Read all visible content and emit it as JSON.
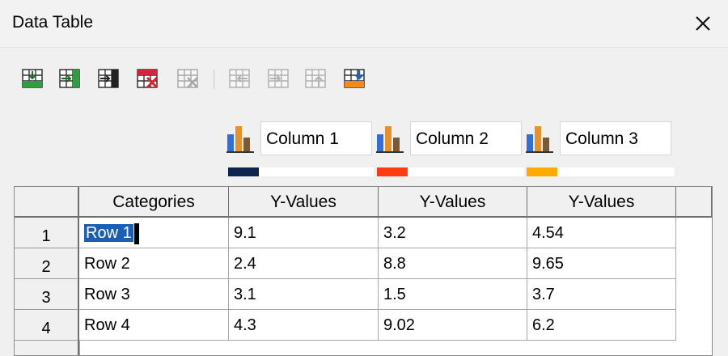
{
  "window": {
    "title": "Data Table"
  },
  "toolbar": {
    "buttons": [
      {
        "name": "insert-row-icon",
        "enabled": true
      },
      {
        "name": "insert-column-icon",
        "enabled": true
      },
      {
        "name": "insert-text-column-icon",
        "enabled": true
      },
      {
        "name": "delete-row-icon",
        "enabled": true
      },
      {
        "name": "delete-column-icon",
        "enabled": false
      },
      {
        "name": "move-column-left-icon",
        "enabled": false
      },
      {
        "name": "move-column-right-icon",
        "enabled": false
      },
      {
        "name": "move-row-up-icon",
        "enabled": false
      },
      {
        "name": "move-row-down-icon",
        "enabled": true
      }
    ]
  },
  "series": [
    {
      "name": "Column 1",
      "color": "#0f2550"
    },
    {
      "name": "Column 2",
      "color": "#ff3b12"
    },
    {
      "name": "Column 3",
      "color": "#ffaa00"
    }
  ],
  "table": {
    "headers": [
      "Categories",
      "Y-Values",
      "Y-Values",
      "Y-Values"
    ],
    "rows": [
      {
        "num": "1",
        "cells": [
          "Row 1",
          "9.1",
          "3.2",
          "4.54"
        ]
      },
      {
        "num": "2",
        "cells": [
          "Row 2",
          "2.4",
          "8.8",
          "9.65"
        ]
      },
      {
        "num": "3",
        "cells": [
          "Row 3",
          "3.1",
          "1.5",
          "3.7"
        ]
      },
      {
        "num": "4",
        "cells": [
          "Row 4",
          "4.3",
          "9.02",
          "6.2"
        ]
      }
    ],
    "selected_cell_text": "Row 1"
  }
}
